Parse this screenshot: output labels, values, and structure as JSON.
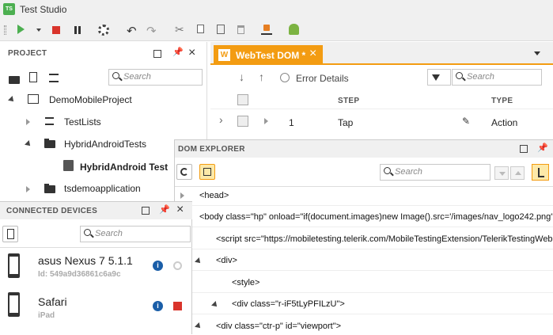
{
  "app": {
    "badge": "TS",
    "title": "Test Studio"
  },
  "project": {
    "header": "PROJECT",
    "search_placeholder": "Search",
    "tree": [
      {
        "label": "DemoMobileProject"
      },
      {
        "label": "TestLists"
      },
      {
        "label": "HybridAndroidTests"
      },
      {
        "label": "HybridAndroid Test"
      },
      {
        "label": "tsdemoapplication"
      }
    ]
  },
  "devices": {
    "header": "CONNECTED DEVICES",
    "search_placeholder": "Search",
    "items": [
      {
        "name": "asus Nexus 7 5.1.1",
        "sub": "Id: 549a9d36861c6a9c"
      },
      {
        "name": "Safari",
        "sub": "iPad"
      }
    ]
  },
  "webtest": {
    "tab_badge": "W",
    "tab_label": "WebTest DOM *",
    "error_details": "Error Details",
    "search_placeholder": "Search",
    "columns": {
      "step": "STEP",
      "type": "TYPE"
    },
    "rows": [
      {
        "num": "1",
        "step": "Tap",
        "type": "Action"
      }
    ]
  },
  "dom": {
    "header": "DOM EXPLORER",
    "search_placeholder": "Search",
    "lines": [
      "<head>",
      "<body class=\"hp\" onload=\"if(document.images)new Image().src='/images/nav_logo242.png'\">",
      "<script src=\"https://mobiletesting.telerik.com/MobileTestingExtension/TelerikTestingWeb",
      "<div>",
      "<style>",
      "<div class=\"r-iF5tLyPFILzU\">",
      "<div class=\"ctr-p\" id=\"viewport\">"
    ]
  },
  "colors": {
    "accent": "#f39c12",
    "green": "#4caf50",
    "red": "#d9342b",
    "info": "#1a5ea8"
  }
}
